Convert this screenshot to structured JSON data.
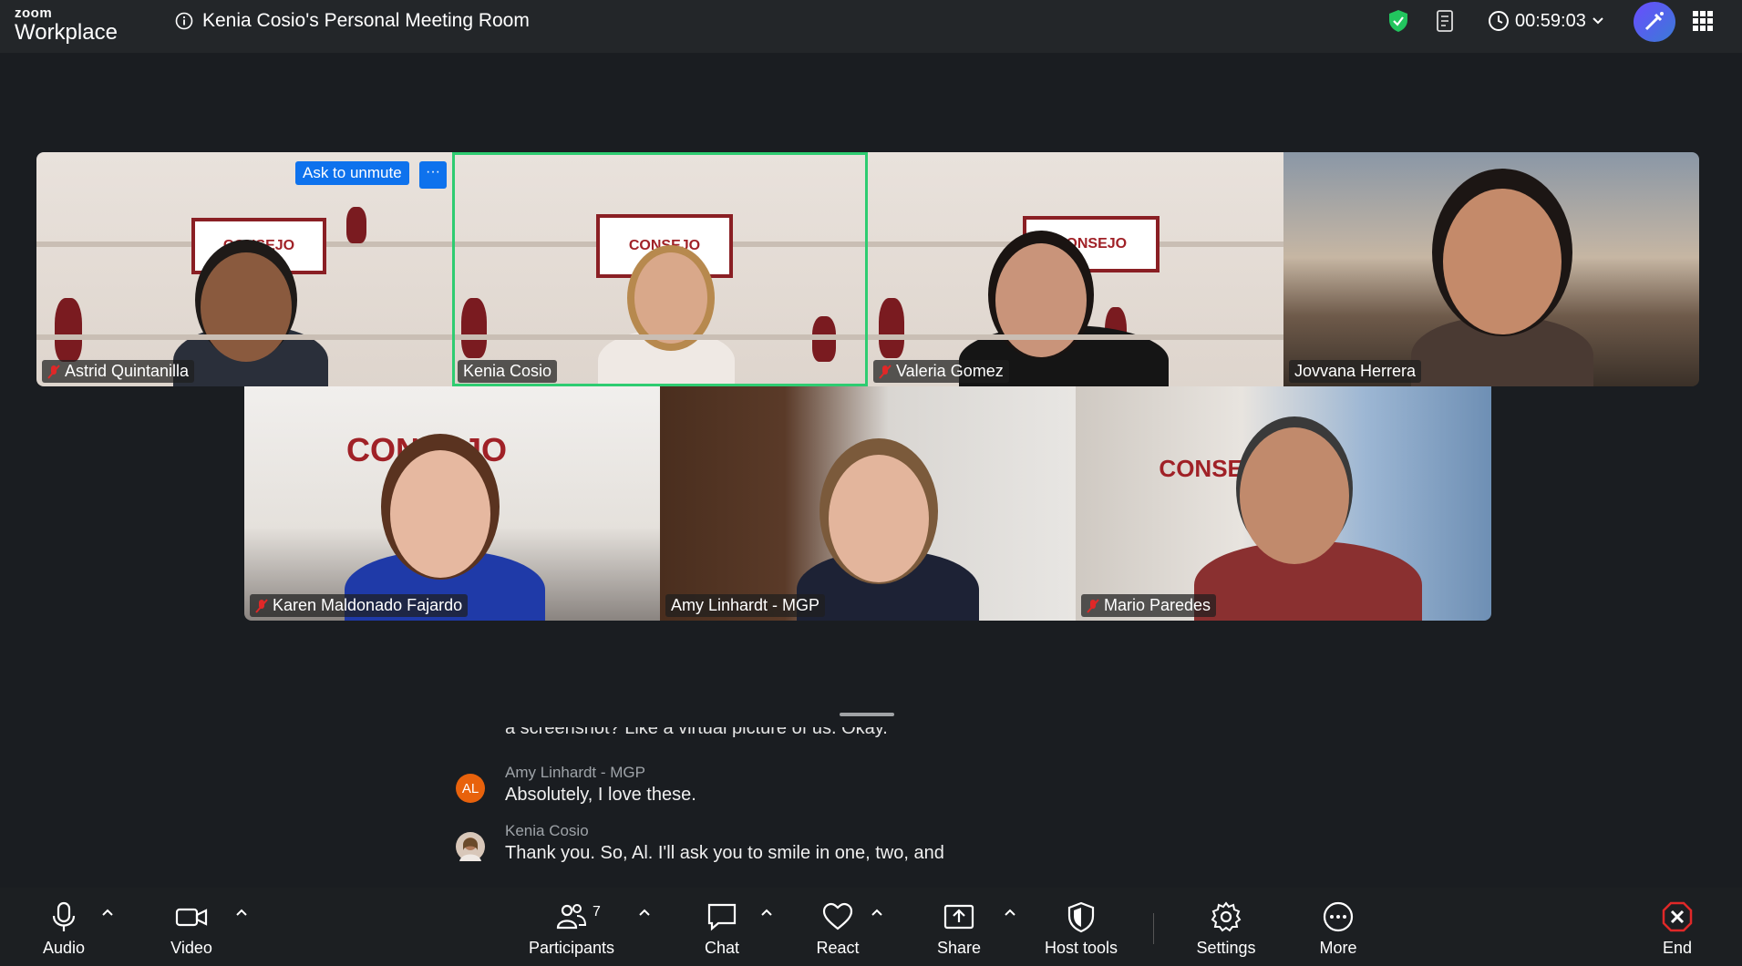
{
  "app": {
    "logo_small": "zoom",
    "logo_big": "Workplace"
  },
  "meeting": {
    "title": "Kenia Cosio's Personal Meeting Room",
    "timer": "00:59:03"
  },
  "tiles": [
    {
      "name": "Astrid Quintanilla",
      "muted": true
    },
    {
      "name": "Kenia Cosio",
      "muted": false,
      "active_speaker": true
    },
    {
      "name": "Valeria Gomez",
      "muted": true
    },
    {
      "name": "Jovvana Herrera",
      "muted": false
    },
    {
      "name": "Karen Maldonado Fajardo",
      "muted": true
    },
    {
      "name": "Amy Linhardt - MGP",
      "muted": false
    },
    {
      "name": "Mario Paredes",
      "muted": true
    }
  ],
  "tile_actions": {
    "ask_unmute": "Ask to unmute",
    "more_dots": "···"
  },
  "brand_text": {
    "consejo": "CONSEJO"
  },
  "transcript": {
    "cut_line": "a screenshot? Like a virtual picture of us. Okay.",
    "entries": [
      {
        "avatar_initials": "AL",
        "avatar_color": "#e8620c",
        "speaker": "Amy Linhardt - MGP",
        "text": "Absolutely, I love these."
      },
      {
        "avatar_initials": "",
        "avatar_color": "#d8c7b9",
        "speaker": "Kenia Cosio",
        "text": "Thank you. So, Al. I'll ask you to smile in one, two, and"
      }
    ]
  },
  "toolbar": {
    "audio": "Audio",
    "video": "Video",
    "participants": "Participants",
    "participants_count": "7",
    "chat": "Chat",
    "react": "React",
    "share": "Share",
    "host_tools": "Host tools",
    "settings": "Settings",
    "more": "More",
    "end": "End"
  },
  "colors": {
    "speaker_border": "#2ecc71",
    "accent_blue": "#0e72ed",
    "end_red": "#e02828",
    "encryption_green": "#22c55e"
  },
  "icons": [
    "info-icon",
    "shield-icon",
    "notes-icon",
    "clock-icon",
    "chevron-down-icon",
    "ai-companion-icon",
    "apps-grid-icon",
    "mic-icon",
    "video-icon",
    "participants-icon",
    "chat-icon",
    "heart-icon",
    "share-icon",
    "host-tools-icon",
    "gear-icon",
    "more-icon",
    "end-icon",
    "mic-off-icon"
  ]
}
